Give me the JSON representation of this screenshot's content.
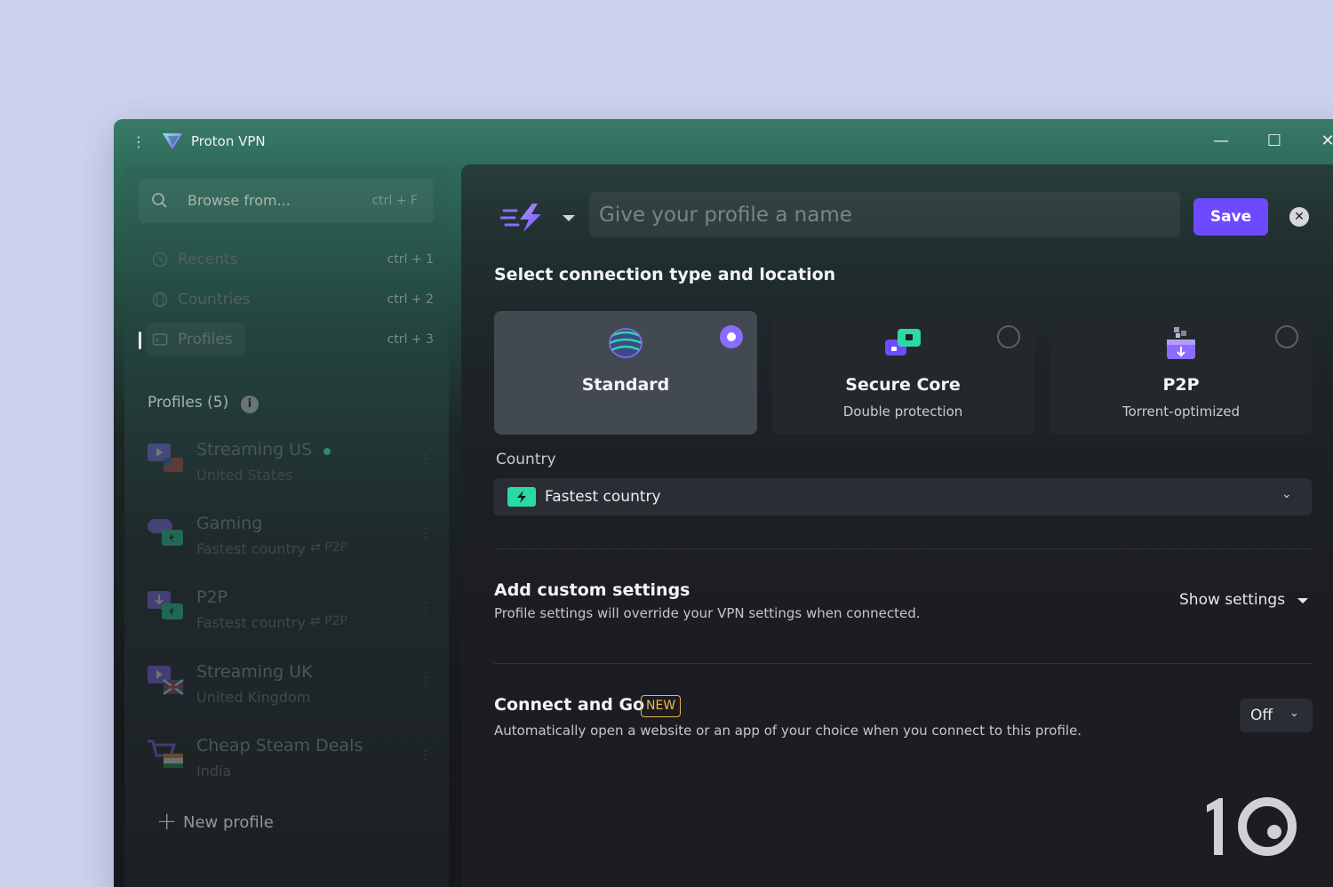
{
  "window": {
    "title": "Proton VPN",
    "colors": {
      "accent": "#6d4aff",
      "accent_radio": "#8a6dff",
      "new_badge": "#f0b34c",
      "teal_flag": "#2bd9a4"
    }
  },
  "sidebar": {
    "search": {
      "placeholder": "Browse from...",
      "shortcut": "ctrl + F"
    },
    "nav": [
      {
        "label": "Recents",
        "shortcut": "ctrl + 1",
        "icon": "clock-icon"
      },
      {
        "label": "Countries",
        "shortcut": "ctrl + 2",
        "icon": "globe-icon"
      },
      {
        "label": "Profiles",
        "shortcut": "ctrl + 3",
        "icon": "profiles-icon",
        "active": true
      }
    ],
    "profiles_header": "Profiles (5)",
    "info_icon": "i",
    "profiles": [
      {
        "name": "Streaming US",
        "location": "United States",
        "online": true,
        "icon": "streaming-icon"
      },
      {
        "name": "Gaming",
        "location": "Fastest country",
        "feature": "P2P",
        "icon": "gaming-icon"
      },
      {
        "name": "P2P",
        "location": "Fastest country",
        "feature": "P2P",
        "icon": "p2p-icon"
      },
      {
        "name": "Streaming UK",
        "location": "United Kingdom",
        "icon": "streaming-icon"
      },
      {
        "name": "Cheap Steam Deals",
        "location": "India",
        "icon": "shopping-icon"
      }
    ],
    "new_profile": "New profile"
  },
  "main": {
    "name_placeholder": "Give your profile a name",
    "save_label": "Save",
    "section_title": "Select connection type and location",
    "connection_types": [
      {
        "title": "Standard",
        "subtitle": "",
        "selected": true,
        "icon": "standard-globe-icon"
      },
      {
        "title": "Secure Core",
        "subtitle": "Double protection",
        "selected": false,
        "icon": "secure-core-icon"
      },
      {
        "title": "P2P",
        "subtitle": "Torrent-optimized",
        "selected": false,
        "icon": "p2p-box-icon"
      }
    ],
    "country_label": "Country",
    "country_value": "Fastest country",
    "custom": {
      "title": "Add custom settings",
      "description": "Profile settings will override your VPN settings when connected.",
      "toggle_label": "Show settings"
    },
    "connect_and_go": {
      "title": "Connect and Go",
      "badge": "NEW",
      "description": "Automatically open a website or an app of your choice when you connect to this profile.",
      "value": "Off"
    }
  }
}
